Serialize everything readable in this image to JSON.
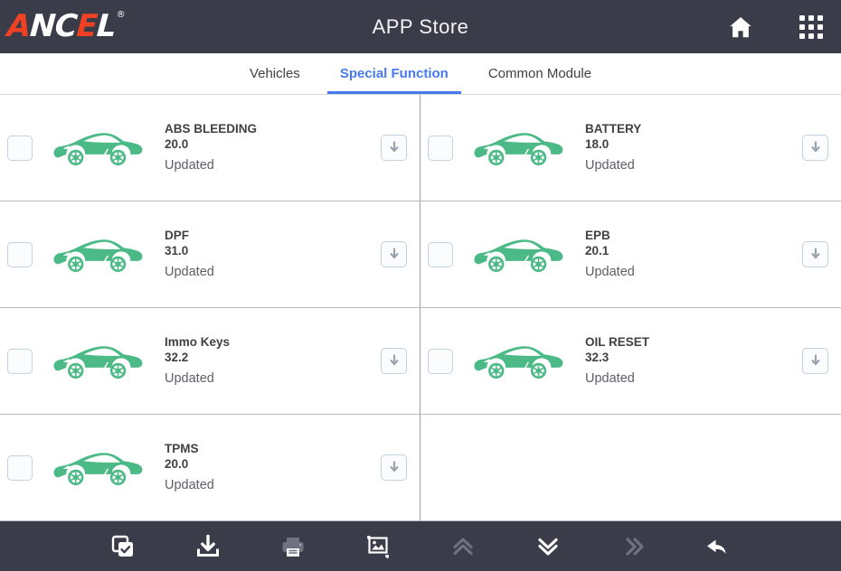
{
  "header": {
    "brand": {
      "part1": "A",
      "part2": "NC",
      "part3": "E",
      "part4": "L",
      "trademark": "®"
    },
    "title": "APP Store",
    "home_icon": "home-icon",
    "apps_icon": "apps-grid-icon",
    "background": "#3a3d49",
    "brand_orange": "#ef4123"
  },
  "tabs": {
    "active_color": "#4679f0",
    "items": [
      {
        "label": "Vehicles",
        "active": false
      },
      {
        "label": "Special Function",
        "active": true
      },
      {
        "label": "Common Module",
        "active": false
      }
    ]
  },
  "apps": [
    {
      "name": "ABS BLEEDING",
      "version": "20.0",
      "status": "Updated",
      "checked": false,
      "icon": "green-car-icon",
      "action": "download-icon"
    },
    {
      "name": "BATTERY",
      "version": "18.0",
      "status": "Updated",
      "checked": false,
      "icon": "green-car-icon",
      "action": "download-icon"
    },
    {
      "name": "DPF",
      "version": "31.0",
      "status": "Updated",
      "checked": false,
      "icon": "green-car-icon",
      "action": "download-icon"
    },
    {
      "name": "EPB",
      "version": "20.1",
      "status": "Updated",
      "checked": false,
      "icon": "green-car-icon",
      "action": "download-icon"
    },
    {
      "name": "Immo Keys",
      "version": "32.2",
      "status": "Updated",
      "checked": false,
      "icon": "green-car-icon",
      "action": "download-icon"
    },
    {
      "name": "OIL RESET",
      "version": "32.3",
      "status": "Updated",
      "checked": false,
      "icon": "green-car-icon",
      "action": "download-icon"
    },
    {
      "name": "TPMS",
      "version": "20.0",
      "status": "Updated",
      "checked": false,
      "icon": "green-car-icon",
      "action": "download-icon"
    }
  ],
  "car_icon_color": "#4cba86",
  "toolbar": {
    "background": "#3a3d49",
    "items": [
      {
        "icon": "select-all-icon",
        "enabled": true
      },
      {
        "icon": "download-icon",
        "enabled": true
      },
      {
        "icon": "printer-icon",
        "enabled": false
      },
      {
        "icon": "screenshot-icon",
        "enabled": true
      },
      {
        "icon": "double-chevron-up-icon",
        "enabled": false
      },
      {
        "icon": "double-chevron-down-icon",
        "enabled": true
      },
      {
        "icon": "double-chevron-right-icon",
        "enabled": false
      },
      {
        "icon": "back-arrow-icon",
        "enabled": true
      }
    ]
  }
}
